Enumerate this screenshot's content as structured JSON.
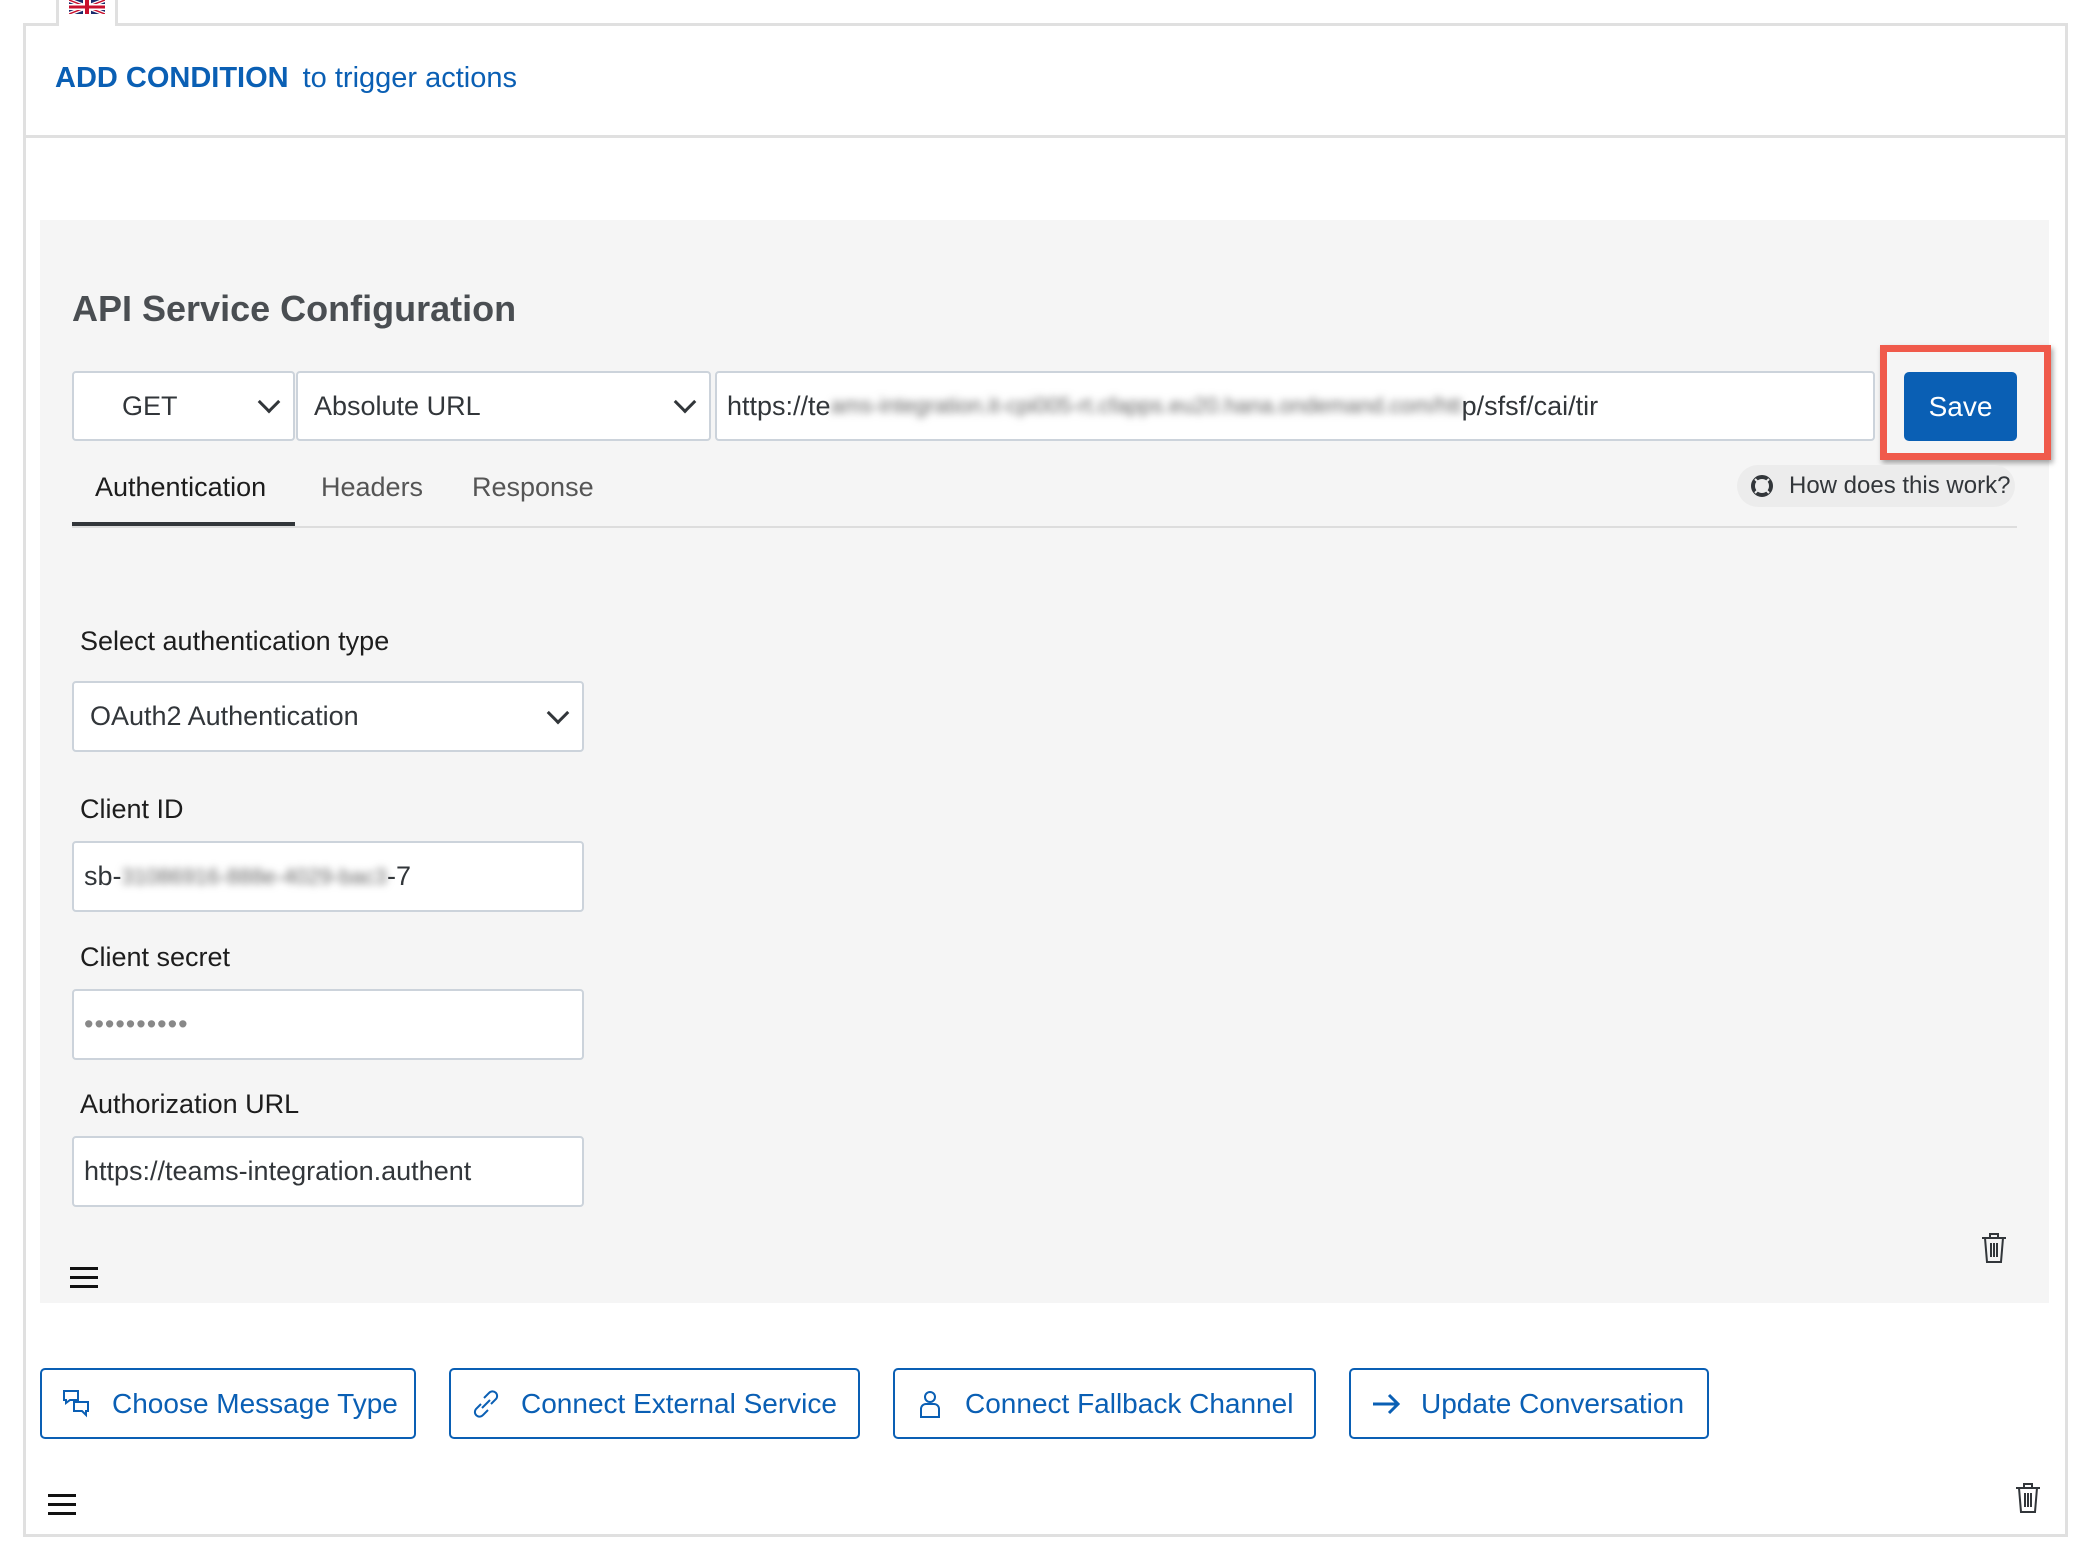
{
  "header": {
    "add_condition": "ADD CONDITION",
    "add_condition_suffix": "to trigger actions"
  },
  "api": {
    "title": "API Service Configuration",
    "method": "GET",
    "url_type": "Absolute URL",
    "url_prefix": "https://te",
    "url_blurred": "ams-integration.it-cpi005-rt.cfapps.eu20.hana.ondemand.com/htt",
    "url_suffix": "p/sfsf/cai/tir",
    "save_label": "Save",
    "tabs": [
      {
        "label": "Authentication"
      },
      {
        "label": "Headers"
      },
      {
        "label": "Response"
      }
    ],
    "help_label": "How does this work?",
    "auth_type_label": "Select authentication type",
    "auth_type": "OAuth2 Authentication",
    "client_id_label": "Client ID",
    "client_id_prefix": "sb-",
    "client_id_blurred": "31086916-888e-4029-bac3",
    "client_id_suffix": "-7",
    "client_secret_label": "Client secret",
    "client_secret": "••••••••••",
    "auth_url_label": "Authorization URL",
    "auth_url": "https://teams-integration.authent"
  },
  "actions": [
    {
      "label": "Choose Message Type",
      "icon": "message-icon"
    },
    {
      "label": "Connect External Service",
      "icon": "link-icon"
    },
    {
      "label": "Connect Fallback Channel",
      "icon": "person-icon"
    },
    {
      "label": "Update Conversation",
      "icon": "arrow-right-icon"
    }
  ],
  "colors": {
    "accent": "#0a5fb4",
    "highlight": "#f05a4b",
    "panel": "#f5f5f5"
  }
}
